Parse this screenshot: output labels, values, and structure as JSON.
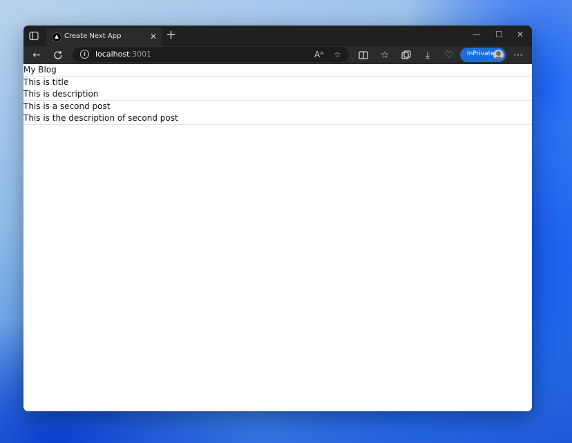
{
  "browser": {
    "tab": {
      "title": "Create Next App"
    },
    "address": {
      "host": "localhost",
      "port": ":3001"
    },
    "inprivate_label": "InPrivate"
  },
  "page": {
    "heading": "My Blog",
    "posts": [
      {
        "title": "This is title",
        "description": "This is description"
      },
      {
        "title": "This is a second post",
        "description": "This is the description of second post"
      }
    ]
  },
  "icons": {
    "tab_actions": "tab-actions-icon",
    "favicon": "nextjs-triangle-icon",
    "close": "close-icon",
    "new_tab": "plus-icon",
    "minimize": "minimize-icon",
    "maximize": "maximize-icon",
    "window_close": "close-icon",
    "back": "arrow-left-icon",
    "refresh": "refresh-icon",
    "info": "info-icon",
    "read_aloud": "read-aloud-icon",
    "favorite": "star-icon",
    "split": "split-screen-icon",
    "favorites": "favorites-icon",
    "collections": "collections-icon",
    "downloads": "download-icon",
    "health": "browser-essentials-icon",
    "menu": "more-icon"
  }
}
